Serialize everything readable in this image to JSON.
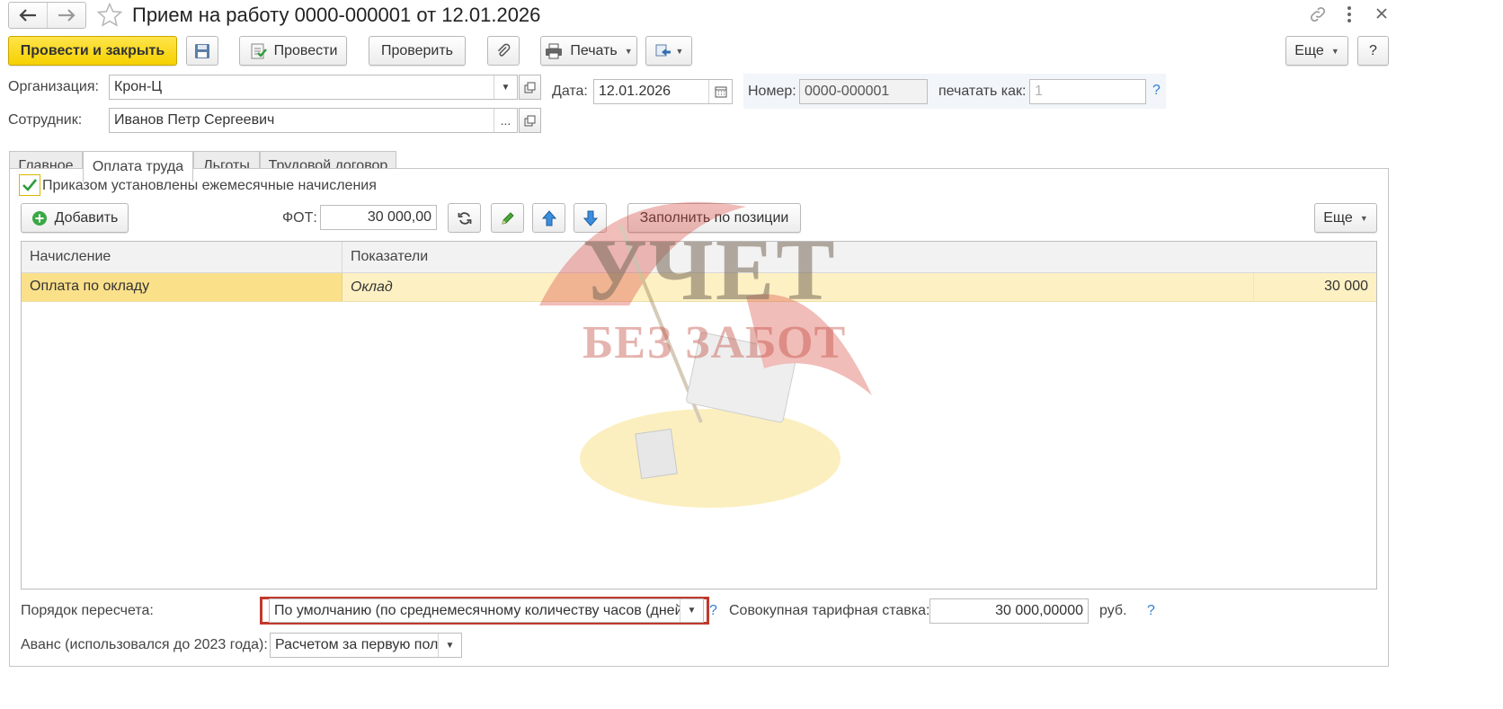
{
  "window": {
    "title": "Прием на работу 0000-000001 от 12.01.2026"
  },
  "toolbar": {
    "post_close_label": "Провести и закрыть",
    "post_label": "Провести",
    "check_label": "Проверить",
    "print_label": "Печать",
    "more_label": "Еще",
    "help_label": "?"
  },
  "header": {
    "org_label": "Организация:",
    "org_value": "Крон-Ц",
    "date_label": "Дата:",
    "date_value": "12.01.2026",
    "number_label": "Номер:",
    "number_value": "0000-000001",
    "print_as_label": "печатать как:",
    "print_as_placeholder": "1",
    "help_mark": "?",
    "employee_label": "Сотрудник:",
    "employee_value": "Иванов Петр Сергеевич",
    "select_dots": "..."
  },
  "tabs": [
    {
      "label": "Главное"
    },
    {
      "label": "Оплата труда"
    },
    {
      "label": "Льготы"
    },
    {
      "label": "Трудовой договор"
    }
  ],
  "payroll": {
    "monthly_checkbox_label": "Приказом установлены ежемесячные начисления",
    "add_label": "Добавить",
    "fot_label": "ФОТ:",
    "fot_value": "30 000,00",
    "fill_by_position_label": "Заполнить по позиции",
    "more_label": "Еще",
    "table": {
      "headers": [
        "Начисление",
        "Показатели"
      ],
      "rows": [
        {
          "accrual": "Оплата по окладу",
          "indicator": "Оклад",
          "amount": "30 000"
        }
      ]
    },
    "recalc_label": "Порядок пересчета:",
    "recalc_value": "По умолчанию (по среднемесячному количеству часов (дней",
    "recalc_help": "?",
    "tariff_label": "Совокупная тарифная ставка:",
    "tariff_value": "30 000,00000",
    "currency": "руб.",
    "tariff_help": "?",
    "advance_label": "Аванс (использовался до 2023 года):",
    "advance_value": "Расчетом за первую поло"
  },
  "watermark": {
    "line1": "УЧЕТ",
    "line2": "БЕЗ ЗАБОТ"
  },
  "colors": {
    "accent_yellow": "#f5d000",
    "row_selected": "#fbe08a",
    "highlight_border": "#c0392b",
    "help_blue": "#2f7fd1",
    "checkbox_green": "#2e9c3a"
  }
}
